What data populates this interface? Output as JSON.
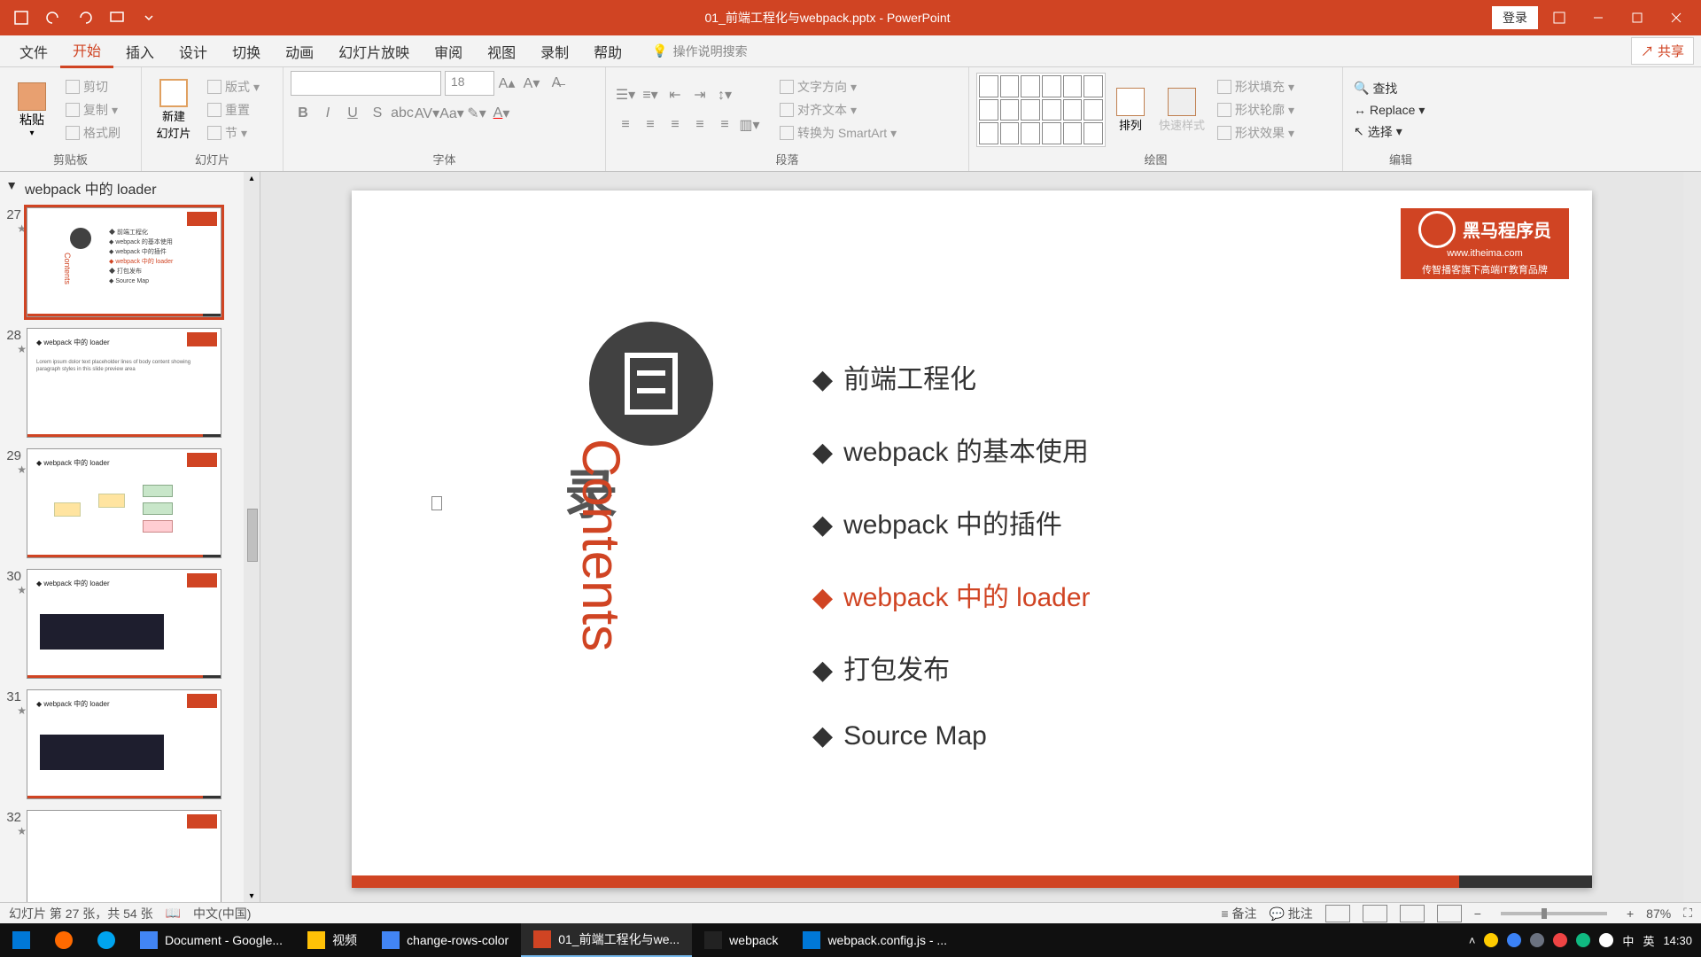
{
  "titlebar": {
    "filename": "01_前端工程化与webpack.pptx - PowerPoint",
    "login": "登录"
  },
  "tabs": {
    "file": "文件",
    "home": "开始",
    "insert": "插入",
    "design": "设计",
    "transitions": "切换",
    "animations": "动画",
    "slideshow": "幻灯片放映",
    "review": "审阅",
    "view": "视图",
    "record": "录制",
    "help": "帮助",
    "tellme": "操作说明搜索",
    "share": "共享"
  },
  "ribbon": {
    "clipboard": {
      "label": "剪贴板",
      "paste": "粘贴",
      "cut": "剪切",
      "copy": "复制",
      "format": "格式刷"
    },
    "slides": {
      "label": "幻灯片",
      "new": "新建\n幻灯片",
      "layout": "版式",
      "reset": "重置",
      "section": "节"
    },
    "font": {
      "label": "字体",
      "size": "18"
    },
    "paragraph": {
      "label": "段落",
      "textdir": "文字方向",
      "align": "对齐文本",
      "smartart": "转换为 SmartArt"
    },
    "drawing": {
      "label": "绘图",
      "arrange": "排列",
      "quick": "快速样式",
      "fill": "形状填充",
      "outline": "形状轮廓",
      "effects": "形状效果"
    },
    "editing": {
      "label": "编辑",
      "find": "查找",
      "replace": "Replace",
      "select": "选择"
    }
  },
  "section": {
    "title": "webpack 中的 loader"
  },
  "thumbs": [
    {
      "num": "27",
      "active": true,
      "kind": "contents"
    },
    {
      "num": "28",
      "active": false,
      "kind": "text"
    },
    {
      "num": "29",
      "active": false,
      "kind": "diagram"
    },
    {
      "num": "30",
      "active": false,
      "kind": "code"
    },
    {
      "num": "31",
      "active": false,
      "kind": "code"
    },
    {
      "num": "32",
      "active": false,
      "kind": "partial"
    }
  ],
  "slide": {
    "logo_brand": "黑马程序员",
    "logo_url": "www.itheima.com",
    "logo_tag": "传智播客旗下高端IT教育品牌",
    "lu": "录",
    "contents": "Contents",
    "items": [
      {
        "text": "前端工程化",
        "hl": false
      },
      {
        "text": "webpack 的基本使用",
        "hl": false
      },
      {
        "text": "webpack 中的插件",
        "hl": false
      },
      {
        "text": "webpack 中的 loader",
        "hl": true
      },
      {
        "text": "打包发布",
        "hl": false
      },
      {
        "text": "Source Map",
        "hl": false
      }
    ]
  },
  "status": {
    "slide_info": "幻灯片 第 27 张，共 54 张",
    "lang": "中文(中国)",
    "notes": "备注",
    "comments": "批注",
    "zoom": "87%"
  },
  "taskbar": {
    "items": [
      {
        "label": "Document - Google..."
      },
      {
        "label": "视频"
      },
      {
        "label": "change-rows-color"
      },
      {
        "label": "01_前端工程化与we..."
      },
      {
        "label": "webpack"
      },
      {
        "label": "webpack.config.js - ..."
      }
    ],
    "ime1": "中",
    "ime2": "英",
    "time": "14:30"
  }
}
